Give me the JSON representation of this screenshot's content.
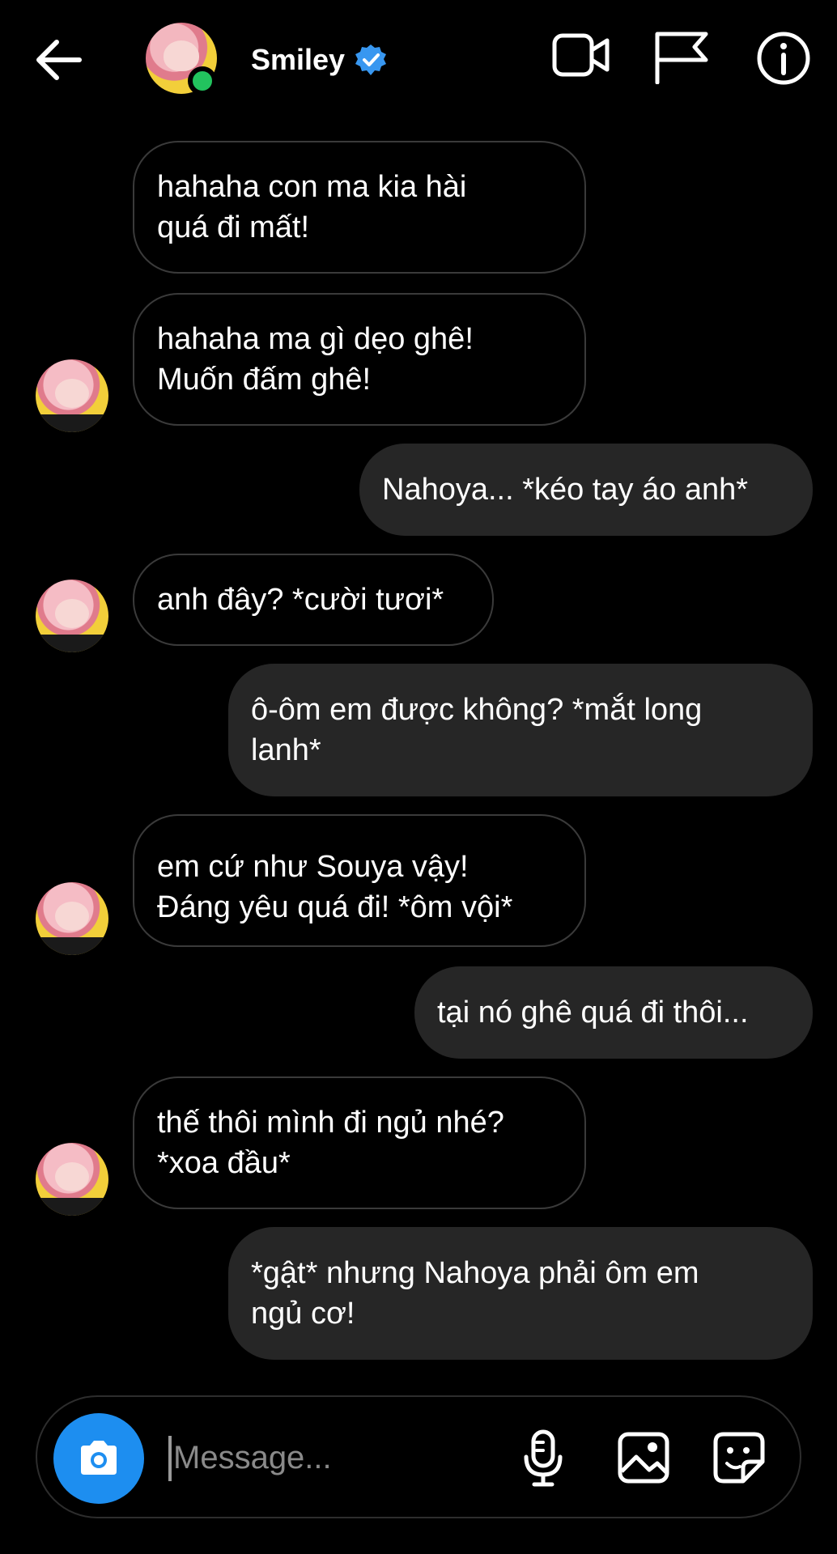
{
  "header": {
    "contact_name": "Smiley"
  },
  "messages": [
    {
      "side": "in",
      "lines": [
        "hahaha con ma kia hài",
        "quá đi mất!"
      ]
    },
    {
      "side": "in",
      "lines": [
        "hahaha ma gì dẹo ghê!",
        "Muốn đấm ghê!"
      ]
    },
    {
      "side": "out",
      "lines": [
        "Nahoya... *kéo tay áo anh*"
      ]
    },
    {
      "side": "in",
      "lines": [
        "anh đây? *cười tươi*"
      ]
    },
    {
      "side": "out",
      "lines": [
        "ô-ôm em được không? *mắt long",
        "lanh*"
      ]
    },
    {
      "side": "in",
      "lines": [
        "em cứ như Souya vậy!",
        "Đáng yêu quá đi! *ôm vội*"
      ]
    },
    {
      "side": "out",
      "lines": [
        "tại nó ghê quá đi thôi..."
      ]
    },
    {
      "side": "in",
      "lines": [
        "thế thôi mình đi ngủ nhé?",
        "*xoa đầu*"
      ]
    },
    {
      "side": "out",
      "lines": [
        "*gật* nhưng Nahoya phải ôm em",
        "ngủ cơ!"
      ]
    }
  ],
  "composer": {
    "placeholder": "Message..."
  },
  "colors": {
    "accent": "#1d8ef0",
    "online": "#22c35e",
    "verified": "#3897f0",
    "outgoing_bubble": "#262626",
    "incoming_border": "#3a3a3a"
  },
  "icons": [
    "back-arrow-icon",
    "verified-badge-icon",
    "video-call-icon",
    "flag-icon",
    "info-icon",
    "camera-icon",
    "microphone-icon",
    "gallery-icon",
    "sticker-icon"
  ]
}
